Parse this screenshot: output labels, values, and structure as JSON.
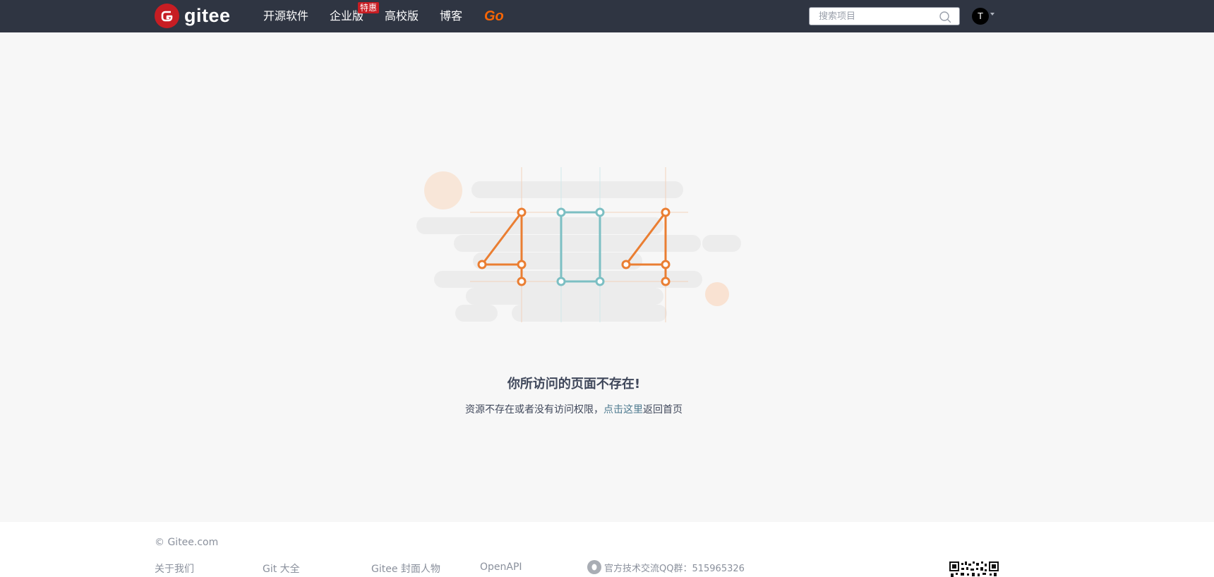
{
  "header": {
    "brand": "gitee",
    "nav": [
      "开源软件",
      "企业版",
      "高校版",
      "博客",
      "Go"
    ],
    "promo_badge": "特惠",
    "search_placeholder": "搜索项目",
    "avatar_letter": "T"
  },
  "error": {
    "code_art": "404",
    "title": "你所访问的页面不存在!",
    "desc_prefix": "资源不存在或者没有访问权限，",
    "desc_link": "点击这里",
    "desc_suffix": "返回首页"
  },
  "footer": {
    "copyright": "© Gitee.com",
    "links": [
      "关于我们",
      "Git 大全",
      "Gitee 封面人物",
      "OpenAPI"
    ],
    "qq_group": "官方技术交流QQ群：515965326"
  },
  "colors": {
    "header_bg": "#2f3542",
    "brand_red": "#c71d23",
    "go_orange": "#f76505",
    "art_orange": "#ea7e32",
    "art_teal": "#7cbfc3"
  }
}
